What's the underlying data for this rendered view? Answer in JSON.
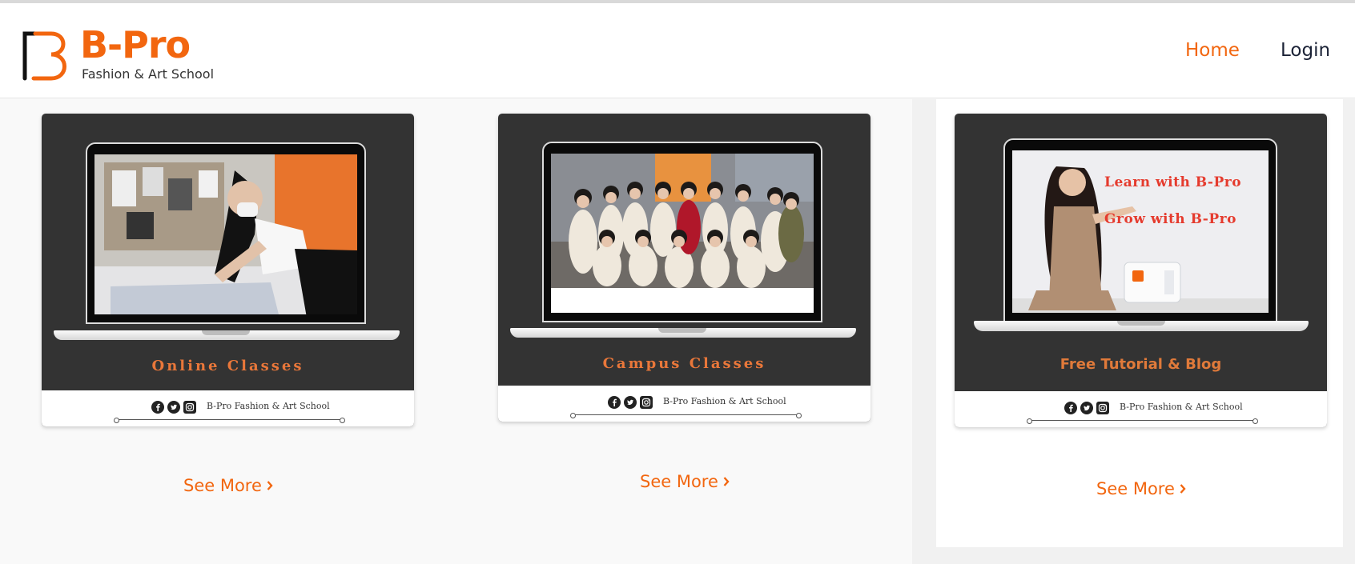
{
  "brand": {
    "name": "B-Pro",
    "tagline": "Fashion & Art School"
  },
  "nav": {
    "home": "Home",
    "login": "Login"
  },
  "colors": {
    "accent": "#f2660f",
    "card_dark": "#333333",
    "nav_dark": "#1b2236"
  },
  "cards": [
    {
      "title": "Online Classes",
      "footer_text": "B-Pro Fashion & Art School",
      "see_more": "See More",
      "image": "woman-cutting-fabric-pattern-photo"
    },
    {
      "title": "Campus Classes",
      "footer_text": "B-Pro Fashion & Art School",
      "see_more": "See More",
      "image": "student-group-photo"
    },
    {
      "title": "Free Tutorial & Blog",
      "footer_text": "B-Pro Fashion & Art School",
      "see_more": "See More",
      "image": "presenter-with-sewing-machine-photo",
      "screen_text": [
        "Learn with B-Pro",
        "Grow with B-Pro"
      ]
    }
  ],
  "social_icons": [
    "facebook-icon",
    "twitter-icon",
    "instagram-icon"
  ]
}
